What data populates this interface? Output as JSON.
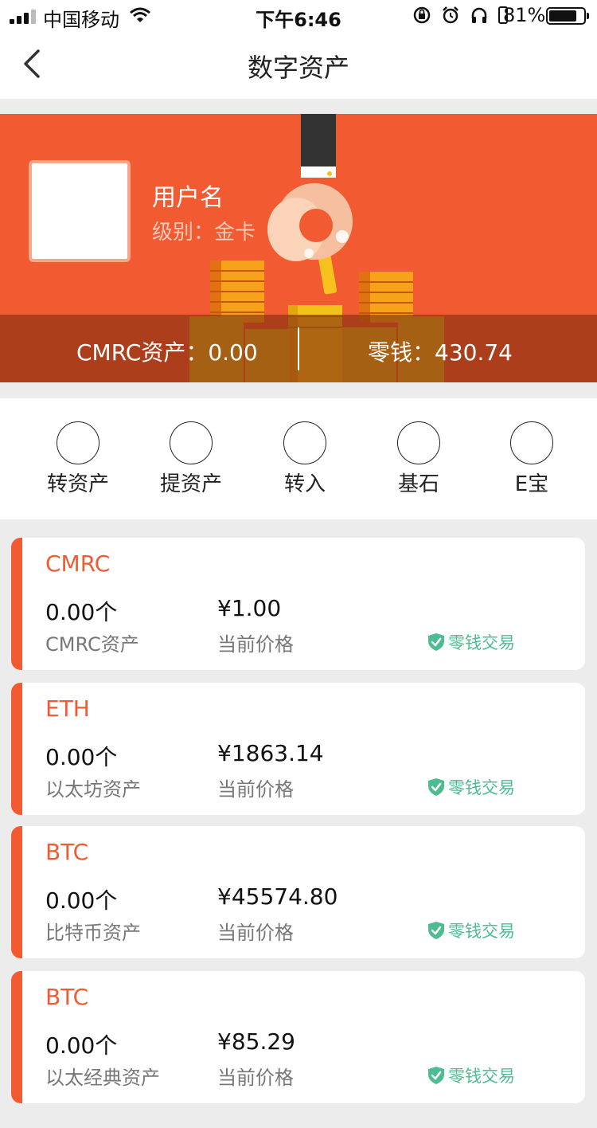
{
  "status_bar": {
    "carrier": "中国移动",
    "time": "下午6:46",
    "battery_percent_text": "81%",
    "battery_level": 0.81,
    "icons": [
      "signal-icon",
      "wifi-icon",
      "rotation-lock-icon",
      "alarm-icon",
      "headphones-icon",
      "battery-icon"
    ]
  },
  "nav": {
    "title": "数字资产",
    "back_icon": "chevron-left-icon"
  },
  "profile": {
    "username": "用户名",
    "level": "级别：金卡"
  },
  "asset_bar": {
    "cmrc_label": "CMRC资产：0.00",
    "change_label": "零钱：430.74"
  },
  "actions": [
    {
      "label": "转资产"
    },
    {
      "label": "提资产"
    },
    {
      "label": "转入"
    },
    {
      "label": "基石"
    },
    {
      "label": "E宝"
    }
  ],
  "assets": [
    {
      "symbol": "CMRC",
      "amount": "0.00个",
      "amount_label": "CMRC资产",
      "price": "¥1.00",
      "price_label": "当前价格",
      "trade_label": "零钱交易"
    },
    {
      "symbol": "ETH",
      "amount": "0.00个",
      "amount_label": "以太坊资产",
      "price": "¥1863.14",
      "price_label": "当前价格",
      "trade_label": "零钱交易"
    },
    {
      "symbol": "BTC",
      "amount": "0.00个",
      "amount_label": "比特币资产",
      "price": "¥45574.80",
      "price_label": "当前价格",
      "trade_label": "零钱交易"
    },
    {
      "symbol": "BTC",
      "amount": "0.00个",
      "amount_label": "以太经典资产",
      "price": "¥85.29",
      "price_label": "当前价格",
      "trade_label": "零钱交易"
    }
  ],
  "colors": {
    "accent": "#f25a31",
    "trade_green": "#4dbd91",
    "background": "#ececec"
  }
}
